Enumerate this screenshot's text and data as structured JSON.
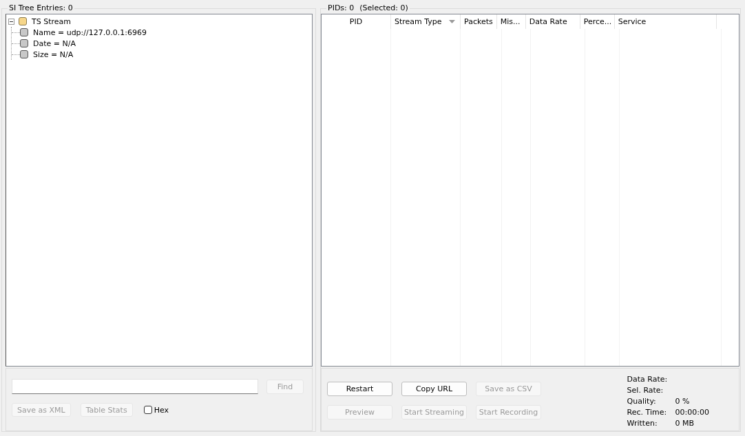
{
  "si_tree": {
    "title": "SI Tree Entries: 0",
    "nodes": [
      {
        "label": "TS Stream",
        "kind": "folder",
        "expanded": true,
        "children": [
          {
            "label": "Name = udp://127.0.0.1:6969",
            "kind": "leaf"
          },
          {
            "label": "Date = N/A",
            "kind": "leaf"
          },
          {
            "label": "Size = N/A",
            "kind": "leaf"
          }
        ]
      }
    ]
  },
  "search": {
    "find_button": {
      "label": "Find",
      "disabled": true
    }
  },
  "left_buttons": [
    {
      "label": "Save as XML",
      "disabled": true
    },
    {
      "label": "Table Stats",
      "disabled": true
    }
  ],
  "hex_checkbox": {
    "label": "Hex",
    "checked": false
  },
  "pids": {
    "title": "PIDs: 0",
    "selected_count": "(Selected: 0)",
    "columns": [
      {
        "label": "PID",
        "sorted": false
      },
      {
        "label": "Stream Type",
        "sorted": true
      },
      {
        "label": "Packets",
        "sorted": false
      },
      {
        "label": "Mis...",
        "sorted": false
      },
      {
        "label": "Data Rate",
        "sorted": false
      },
      {
        "label": "Perce...",
        "sorted": false
      },
      {
        "label": "Service",
        "sorted": false
      }
    ]
  },
  "right_buttons": [
    {
      "label": "Restart",
      "disabled": false
    },
    {
      "label": "Copy URL",
      "disabled": false
    },
    {
      "label": "Save as CSV",
      "disabled": true
    },
    {
      "label": "Preview",
      "disabled": true
    },
    {
      "label": "Start Streaming",
      "disabled": true
    },
    {
      "label": "Start Recording",
      "disabled": true
    }
  ],
  "stats": [
    {
      "label": "Data Rate:"
    },
    {
      "label": "Sel. Rate:"
    },
    {
      "label": "Quality:",
      "value": "0 %"
    },
    {
      "label": "Rec. Time:",
      "value": "00:00:00"
    },
    {
      "label": "Written:",
      "value": "0 MB"
    }
  ]
}
